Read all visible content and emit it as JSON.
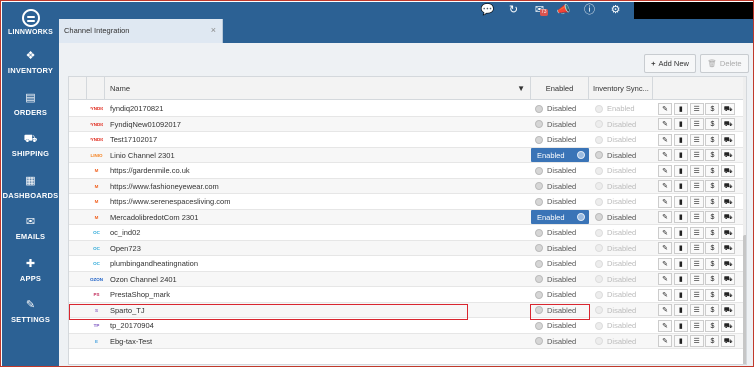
{
  "sidebar": {
    "logo": "LINNWORKS",
    "items": [
      {
        "label": "INVENTORY",
        "icon": "cubes-icon",
        "glyph": "❖"
      },
      {
        "label": "ORDERS",
        "icon": "book-icon",
        "glyph": "▤"
      },
      {
        "label": "SHIPPING",
        "icon": "truck-icon",
        "glyph": "⛟"
      },
      {
        "label": "DASHBOARDS",
        "icon": "bar-chart-icon",
        "glyph": "▦"
      },
      {
        "label": "EMAILS",
        "icon": "envelope-icon",
        "glyph": "✉"
      },
      {
        "label": "APPS",
        "icon": "puzzle-icon",
        "glyph": "✚"
      },
      {
        "label": "SETTINGS",
        "icon": "wrench-icon",
        "glyph": "✎"
      }
    ]
  },
  "topbar": {
    "email_badge": "73"
  },
  "tab": {
    "title": "Channel Integration",
    "close": "×"
  },
  "toolbar": {
    "add_label": "Add New",
    "delete_label": "Delete"
  },
  "table": {
    "headers": {
      "name": "Name",
      "enabled": "Enabled",
      "inventory": "Inventory Sync..."
    },
    "rows": [
      {
        "name": "fyndiq20170821",
        "logo": "FYNDIQ",
        "logo_color": "#e0281b",
        "enabled": "Disabled",
        "inv": "Enabled",
        "inv_faded": true
      },
      {
        "name": "FyndiqNew01092017",
        "logo": "FYNDIQ",
        "logo_color": "#e0281b",
        "enabled": "Disabled",
        "inv": "Disabled",
        "inv_faded": true
      },
      {
        "name": "Test17102017",
        "logo": "FYNDIQ",
        "logo_color": "#e0281b",
        "enabled": "Disabled",
        "inv": "Disabled",
        "inv_faded": true
      },
      {
        "name": "Linio Channel 2301",
        "logo": "LINIO",
        "logo_color": "#f58220",
        "enabled": "Enabled",
        "inv": "Disabled",
        "inv_faded": false
      },
      {
        "name": "https://gardenmile.co.uk",
        "logo": "M",
        "logo_color": "#f26322",
        "enabled": "Disabled",
        "inv": "Disabled",
        "inv_faded": true
      },
      {
        "name": "https://www.fashioneyewear.com",
        "logo": "M",
        "logo_color": "#f26322",
        "enabled": "Disabled",
        "inv": "Disabled",
        "inv_faded": true
      },
      {
        "name": "https://www.serenespacesliving.com",
        "logo": "M",
        "logo_color": "#f26322",
        "enabled": "Disabled",
        "inv": "Disabled",
        "inv_faded": true
      },
      {
        "name": "MercadolibredotCom 2301",
        "logo": "M",
        "logo_color": "#f26322",
        "enabled": "Enabled",
        "inv": "Disabled",
        "inv_faded": false
      },
      {
        "name": "oc_ind02",
        "logo": "OC",
        "logo_color": "#29a8d8",
        "enabled": "Disabled",
        "inv": "Disabled",
        "inv_faded": true
      },
      {
        "name": "Open723",
        "logo": "OC",
        "logo_color": "#29a8d8",
        "enabled": "Disabled",
        "inv": "Disabled",
        "inv_faded": true
      },
      {
        "name": "plumbingandheatingnation",
        "logo": "OC",
        "logo_color": "#29a8d8",
        "enabled": "Disabled",
        "inv": "Disabled",
        "inv_faded": true
      },
      {
        "name": "Ozon Channel 2401",
        "logo": "OZON",
        "logo_color": "#1b5fc6",
        "enabled": "Disabled",
        "inv": "Disabled",
        "inv_faded": true
      },
      {
        "name": "PrestaShop_mark",
        "logo": "PS",
        "logo_color": "#c22b5a",
        "enabled": "Disabled",
        "inv": "Disabled",
        "inv_faded": true
      },
      {
        "name": "Sparto_TJ",
        "logo": "S",
        "logo_color": "#8b5fbf",
        "enabled": "Disabled",
        "inv": "Disabled",
        "inv_faded": true
      },
      {
        "name": "tp_20170904",
        "logo": "TP",
        "logo_color": "#7e57c2",
        "enabled": "Disabled",
        "inv": "Disabled",
        "inv_faded": true
      },
      {
        "name": "Ebg-tax-Test",
        "logo": "E",
        "logo_color": "#4aa3df",
        "enabled": "Disabled",
        "inv": "Disabled",
        "inv_faded": true
      }
    ]
  },
  "colors": {
    "brand": "#2c6194",
    "enabled_toggle": "#3a74b7",
    "highlight": "#d9262f"
  }
}
